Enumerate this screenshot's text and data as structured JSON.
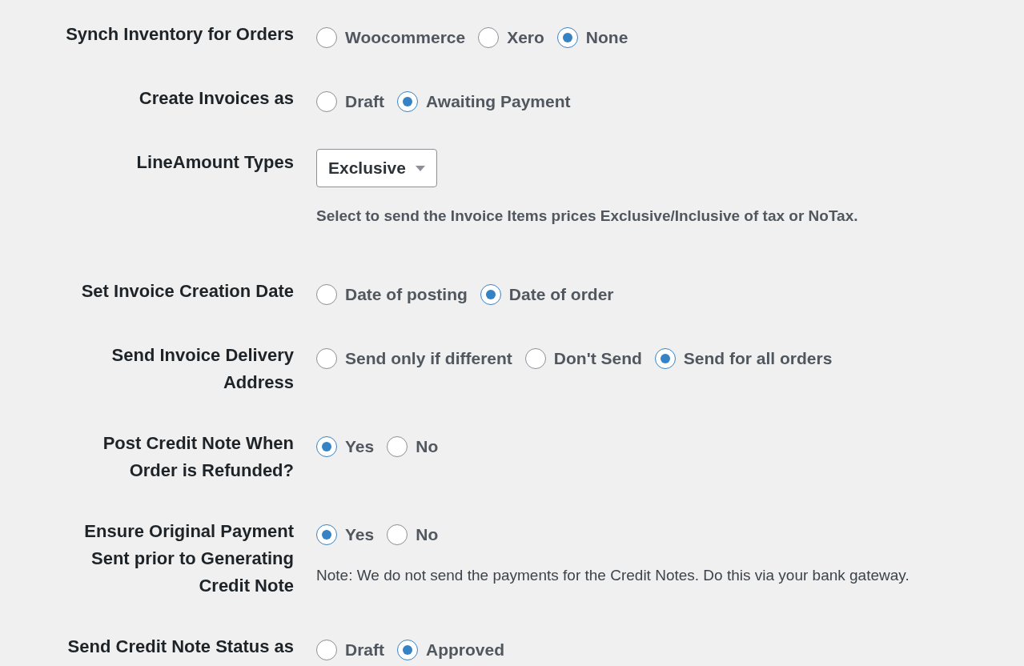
{
  "settings": [
    {
      "kind": "radio",
      "label": "Synch Inventory for Orders",
      "options": [
        {
          "label": "Woocommerce",
          "selected": false
        },
        {
          "label": "Xero",
          "selected": false
        },
        {
          "label": "None",
          "selected": true
        }
      ]
    },
    {
      "kind": "radio",
      "label": "Create Invoices as",
      "options": [
        {
          "label": "Draft",
          "selected": false
        },
        {
          "label": "Awaiting Payment",
          "selected": true
        }
      ]
    },
    {
      "kind": "select",
      "label": "LineAmount Types",
      "value": "Exclusive",
      "description": "Select to send the Invoice Items prices Exclusive/Inclusive of tax or NoTax."
    },
    {
      "kind": "radio",
      "label": "Set Invoice Creation Date",
      "options": [
        {
          "label": "Date of posting",
          "selected": false
        },
        {
          "label": "Date of order",
          "selected": true
        }
      ]
    },
    {
      "kind": "radio",
      "label": "Send Invoice Delivery Address",
      "options": [
        {
          "label": "Send only if different",
          "selected": false
        },
        {
          "label": "Don't Send",
          "selected": false
        },
        {
          "label": "Send for all orders",
          "selected": true
        }
      ]
    },
    {
      "kind": "radio",
      "label": "Post Credit Note When Order is Refunded?",
      "options": [
        {
          "label": "Yes",
          "selected": true
        },
        {
          "label": "No",
          "selected": false
        }
      ]
    },
    {
      "kind": "radio",
      "label": "Ensure Original Payment Sent prior to Generating Credit Note",
      "options": [
        {
          "label": "Yes",
          "selected": true
        },
        {
          "label": "No",
          "selected": false
        }
      ],
      "note": "Note: We do not send the payments for the Credit Notes. Do this via your bank gateway."
    },
    {
      "kind": "radio",
      "label": "Send Credit Note Status as",
      "options": [
        {
          "label": "Draft",
          "selected": false
        },
        {
          "label": "Approved",
          "selected": true
        }
      ]
    }
  ]
}
